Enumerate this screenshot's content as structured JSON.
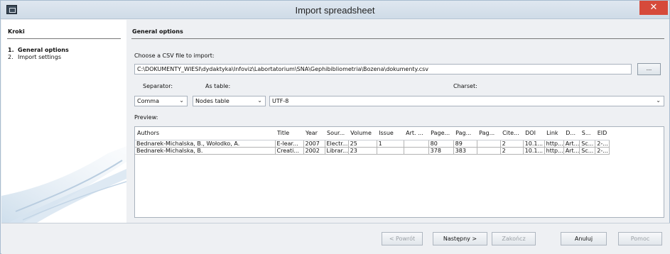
{
  "window": {
    "title": "Import spreadsheet",
    "close": "✕"
  },
  "sidebar": {
    "title": "Kroki",
    "steps": [
      {
        "num": "1.",
        "label": "General options"
      },
      {
        "num": "2.",
        "label": "Import settings"
      }
    ]
  },
  "main": {
    "section_title": "General options",
    "choose_label": "Choose a CSV file to import:",
    "file_path": "C:\\DOKUMENTY_WIESI\\dydaktyka\\Infoviz\\Labortatorium\\SNA\\Gephibibliometria\\Bozena\\dokumenty.csv",
    "browse_label": "...",
    "separator_label": "Separator:",
    "as_table_label": "As table:",
    "charset_label": "Charset:",
    "separator_value": "Comma",
    "as_table_value": "Nodes table",
    "charset_value": "UTF-8",
    "preview_label": "Preview:"
  },
  "preview_table": {
    "headers": [
      "Authors",
      "Title",
      "Year",
      "Sour...",
      "Volume",
      "Issue",
      "Art. ...",
      "Page...",
      "Pag...",
      "Pag...",
      "Cite...",
      "DOI",
      "Link",
      "D...",
      "S...",
      "EID"
    ],
    "rows": [
      [
        "Bednarek-Michalska, B., Wołodko, A.",
        "E-lear...",
        "2007",
        "Electr...",
        "25",
        "1",
        "",
        "80",
        "89",
        "",
        "2",
        "10.1...",
        "http...",
        "Art...",
        "Sc...",
        "2-..."
      ],
      [
        "Bednarek-Michalska, B.",
        "Creati...",
        "2002",
        "Librar...",
        "23",
        "",
        "",
        "378",
        "383",
        "",
        "2",
        "10.1...",
        "http...",
        "Art...",
        "Sc...",
        "2-..."
      ]
    ]
  },
  "footer": {
    "back": "< Powrót",
    "next": "Następny >",
    "finish": "Zakończ",
    "cancel": "Anuluj",
    "help": "Pomoc"
  }
}
